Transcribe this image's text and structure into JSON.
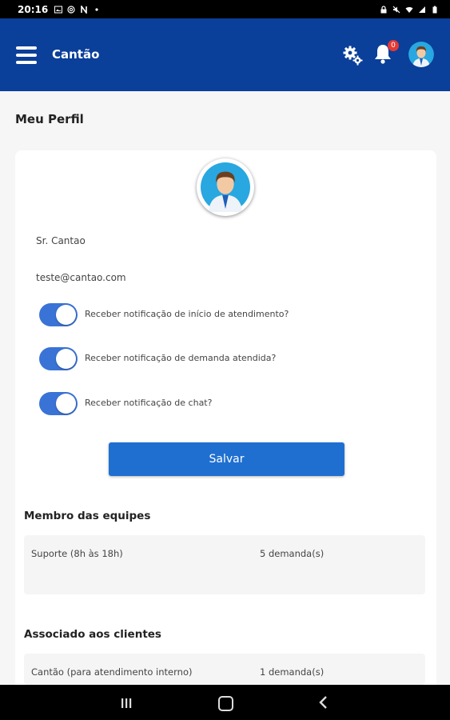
{
  "status_bar": {
    "time": "20:16",
    "left_icons": [
      "image-icon",
      "at-sign-icon",
      "n-icon",
      "dot-icon"
    ],
    "right_icons": [
      "lock-icon",
      "mute-icon",
      "wifi-icon",
      "signal-icon",
      "battery-icon"
    ]
  },
  "header": {
    "title": "Cantão",
    "notification_count": "0",
    "colors": {
      "background": "#0a3f9a",
      "badge": "#e53935"
    }
  },
  "page": {
    "title": "Meu Perfil"
  },
  "profile": {
    "name": "Sr. Cantao",
    "email": "teste@cantao.com",
    "toggles": [
      {
        "label": "Receber notificação de início de atendimento?",
        "checked": true
      },
      {
        "label": "Receber notificação de demanda atendida?",
        "checked": true
      },
      {
        "label": "Receber notificação de chat?",
        "checked": true
      }
    ],
    "save_label": "Salvar",
    "accent": "#1f6fd1"
  },
  "teams": {
    "title": "Membro das equipes",
    "rows": [
      {
        "name": "Suporte (8h às 18h)",
        "count": "5 demanda(s)"
      }
    ]
  },
  "clients": {
    "title": "Associado aos clientes",
    "rows": [
      {
        "name": "Cantão  (para atendimento interno)",
        "count": "1 demanda(s)"
      }
    ]
  },
  "nav_bar": {
    "icons": [
      "recents-icon",
      "home-icon",
      "back-icon"
    ]
  }
}
